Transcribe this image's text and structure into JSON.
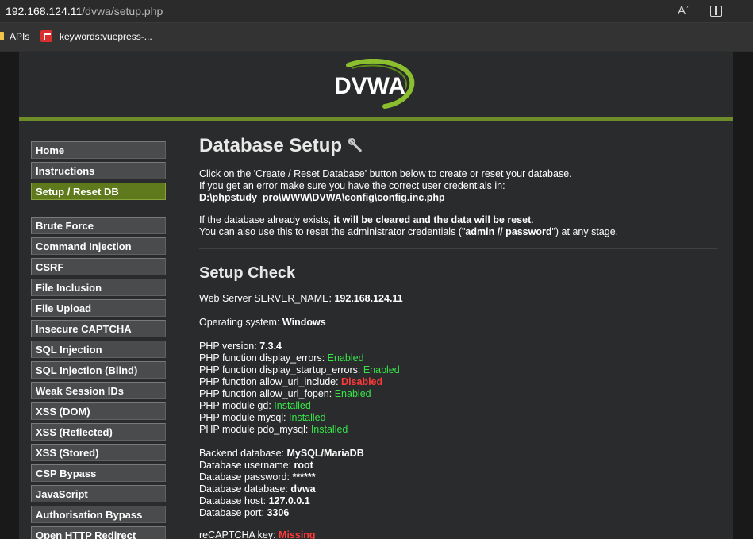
{
  "browser": {
    "url_host": "192.168.124.11",
    "url_path": "/dvwa/setup.php",
    "read_aloud_icon_text": "Aʾ",
    "bookmarks": [
      {
        "label": "APIs"
      },
      {
        "label": "keywords:vuepress-..."
      }
    ]
  },
  "logo": {
    "text": "DVWA"
  },
  "menu": {
    "group1": [
      {
        "label": "Home"
      },
      {
        "label": "Instructions"
      },
      {
        "label": "Setup / Reset DB",
        "selected": true
      }
    ],
    "group2": [
      {
        "label": "Brute Force"
      },
      {
        "label": "Command Injection"
      },
      {
        "label": "CSRF"
      },
      {
        "label": "File Inclusion"
      },
      {
        "label": "File Upload"
      },
      {
        "label": "Insecure CAPTCHA"
      },
      {
        "label": "SQL Injection"
      },
      {
        "label": "SQL Injection (Blind)"
      },
      {
        "label": "Weak Session IDs"
      },
      {
        "label": "XSS (DOM)"
      },
      {
        "label": "XSS (Reflected)"
      },
      {
        "label": "XSS (Stored)"
      },
      {
        "label": "CSP Bypass"
      },
      {
        "label": "JavaScript"
      },
      {
        "label": "Authorisation Bypass"
      },
      {
        "label": "Open HTTP Redirect"
      }
    ]
  },
  "main": {
    "title": "Database Setup",
    "intro_line1": "Click on the 'Create / Reset Database' button below to create or reset your database.",
    "intro_line2": "If you get an error make sure you have the correct user credentials in:",
    "config_path": "D:\\phpstudy_pro\\WWW\\DVWA\\config\\config.inc.php",
    "warn_prefix": "If the database already exists, ",
    "warn_bold": "it will be cleared and the data will be reset",
    "warn_suffix": ".",
    "reset_prefix": "You can also use this to reset the administrator credentials (\"",
    "reset_bold": "admin // password",
    "reset_suffix": "\") at any stage.",
    "check_title": "Setup Check",
    "server_name_label": "Web Server SERVER_NAME: ",
    "server_name_value": "192.168.124.11",
    "os_label": "Operating system: ",
    "os_value": "Windows",
    "php_version_label": "PHP version: ",
    "php_version_value": "7.3.4",
    "php_checks": [
      {
        "label": "PHP function display_errors: ",
        "value": "Enabled",
        "status": "ok"
      },
      {
        "label": "PHP function display_startup_errors: ",
        "value": "Enabled",
        "status": "ok"
      },
      {
        "label": "PHP function allow_url_include: ",
        "value": "Disabled",
        "status": "bad"
      },
      {
        "label": "PHP function allow_url_fopen: ",
        "value": "Enabled",
        "status": "ok"
      },
      {
        "label": "PHP module gd: ",
        "value": "Installed",
        "status": "ok"
      },
      {
        "label": "PHP module mysql: ",
        "value": "Installed",
        "status": "ok"
      },
      {
        "label": "PHP module pdo_mysql: ",
        "value": "Installed",
        "status": "ok"
      }
    ],
    "db": [
      {
        "label": "Backend database: ",
        "value": "MySQL/MariaDB"
      },
      {
        "label": "Database username: ",
        "value": "root"
      },
      {
        "label": "Database password: ",
        "value": "******"
      },
      {
        "label": "Database database: ",
        "value": "dvwa"
      },
      {
        "label": "Database host: ",
        "value": "127.0.0.1"
      },
      {
        "label": "Database port: ",
        "value": "3306"
      }
    ],
    "recaptcha_label": "reCAPTCHA key: ",
    "recaptcha_value": "Missing"
  },
  "colors": {
    "accent_green": "#6f8c2a",
    "status_ok": "#38e34a",
    "status_bad": "#ff3a3a"
  }
}
